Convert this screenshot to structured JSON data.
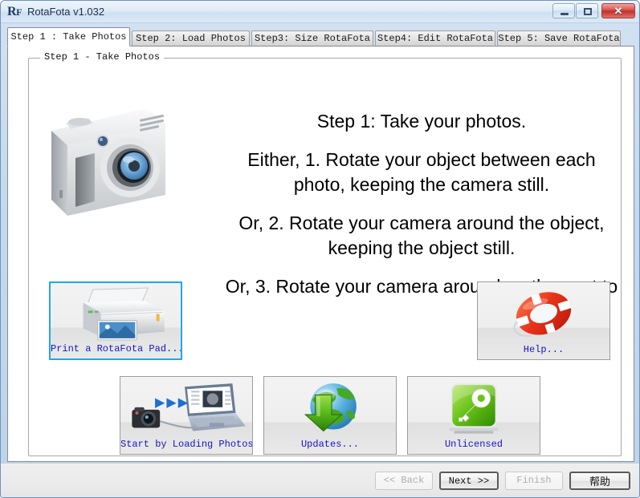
{
  "window": {
    "title": "RotaFota v1.032",
    "icon": "rf-logo-icon",
    "controls": {
      "minimize": "minimize-icon",
      "maximize": "restore-icon",
      "close": "✕"
    }
  },
  "tabs": [
    {
      "label": "Step 1 : Take Photos",
      "active": true
    },
    {
      "label": "Step 2: Load Photos",
      "active": false
    },
    {
      "label": "Step3: Size RotaFota",
      "active": false
    },
    {
      "label": "Step4: Edit RotaFota",
      "active": false
    },
    {
      "label": "Step 5: Save RotaFota",
      "active": false
    }
  ],
  "groupbox": {
    "legend": "Step 1 - Take Photos"
  },
  "instructions": {
    "heading": "Step 1: Take your photos.",
    "option1_line1": "Either, 1. Rotate your object between each",
    "option1_line2": "photo, keeping the camera still.",
    "option2_line1": "Or, 2. Rotate your camera around the object,",
    "option2_line2": "keeping the object still.",
    "option3_line1": "Or, 3. Rotate your camera around on the spot to"
  },
  "illustration": {
    "camera": "digital-camera-illustration"
  },
  "icon_buttons": {
    "print": {
      "caption": "Print a RotaFota Pad...",
      "icon": "printer-icon",
      "focused": true
    },
    "help": {
      "caption": "Help...",
      "icon": "life-ring-icon",
      "focused": false
    },
    "load": {
      "caption": "Start by Loading Photos",
      "icon": "camera-to-laptop-icon",
      "focused": false
    },
    "updates": {
      "caption": "Updates...",
      "icon": "globe-download-icon",
      "focused": false
    },
    "license": {
      "caption": "Unlicensed",
      "icon": "green-key-icon",
      "focused": false
    }
  },
  "footer_buttons": {
    "back": {
      "label": "<< Back",
      "enabled": false,
      "default": false
    },
    "next": {
      "label": "Next >>",
      "enabled": true,
      "default": true
    },
    "finish": {
      "label": "Finish",
      "enabled": false,
      "default": false
    },
    "help": {
      "label": "帮助",
      "enabled": true,
      "default": true
    }
  },
  "colors": {
    "caption_blue": "#1414c8",
    "focus_border": "#1fa8e8",
    "title_bar": "#dfebf8",
    "close_button": "#bf2f2b"
  }
}
